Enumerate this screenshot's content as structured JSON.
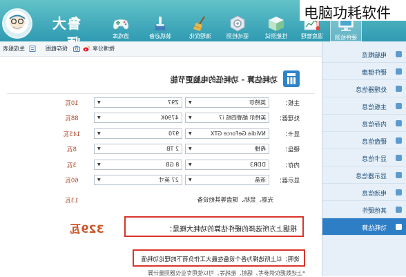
{
  "overlay_title": "电脑功耗软件",
  "logo": {
    "text": "鲁大师",
    "icon": "ludashi-face-logo"
  },
  "nav": {
    "items": [
      {
        "label": "游戏库",
        "icon": "gamepad-icon"
      },
      {
        "label": "装机必备",
        "icon": "paint-brush-icon"
      },
      {
        "label": "清理优化",
        "icon": "broom-icon"
      },
      {
        "label": "驱动检测",
        "icon": "hexagon-gear-icon"
      },
      {
        "label": "性能测试",
        "icon": "benchmark-cube-icon"
      },
      {
        "label": "温度管理",
        "icon": "thermometer-chart-icon"
      },
      {
        "label": "硬件检测",
        "icon": "hardware-monitor-icon",
        "selected": true
      }
    ]
  },
  "toolbar": {
    "items": [
      {
        "label": "生成报表",
        "icon": "report-icon"
      },
      {
        "label": "保存截图",
        "icon": "camera-icon"
      },
      {
        "label": "微博分享",
        "icon": "weibo-icon"
      }
    ]
  },
  "sidebar": {
    "items": [
      {
        "label": "电脑概览"
      },
      {
        "label": "硬件健康"
      },
      {
        "label": "处理器信息"
      },
      {
        "label": "主板信息"
      },
      {
        "label": "内存信息"
      },
      {
        "label": "硬盘信息"
      },
      {
        "label": "显卡信息"
      },
      {
        "label": "显示器信息"
      },
      {
        "label": "电池信息"
      },
      {
        "label": "其他硬件"
      },
      {
        "label": "功耗估算",
        "selected": true
      }
    ]
  },
  "main": {
    "title": "功耗估算 - 功耗低的电脑更节能",
    "rows": [
      {
        "label": "主板：",
        "brand": "英特尔",
        "model": "Z97",
        "power": "10瓦"
      },
      {
        "label": "处理器：",
        "brand": "英特尔 酷睿四核 i7",
        "model": "4790K",
        "power": "88瓦"
      },
      {
        "label": "显卡：",
        "brand": "NVidia GeForce GTX",
        "model": "970",
        "power": "145瓦"
      },
      {
        "label": "硬盘：",
        "brand": "希捷",
        "model": "2 TB",
        "power": "8瓦"
      },
      {
        "label": "内存：",
        "brand": "DDR3",
        "model": "8 GB",
        "power": "3瓦"
      },
      {
        "label": "显示器：",
        "brand": "液晶",
        "model": "27 英寸",
        "power": "60瓦"
      }
    ],
    "other_label": "光驱、鼠标、键盘等其他设备",
    "other_power": "13瓦",
    "total_text": "根据上方所选择的硬件估算的功耗大概是：",
    "total_power": "329瓦",
    "note": "说明：以上所选择为各个设备在最大工作负荷下的理论功耗值",
    "footnote": "*上述数据仅供参考，辐射、能耗等，可以使用专业仪器测量计算"
  },
  "colors": {
    "header": "#34a2b5",
    "sidebar_bg": "#e7f0f8",
    "sidebar_selected": "#2e7ec6",
    "highlight_box": "#d9342b",
    "power_value": "#b44a2b",
    "total_power": "#c9572a"
  }
}
